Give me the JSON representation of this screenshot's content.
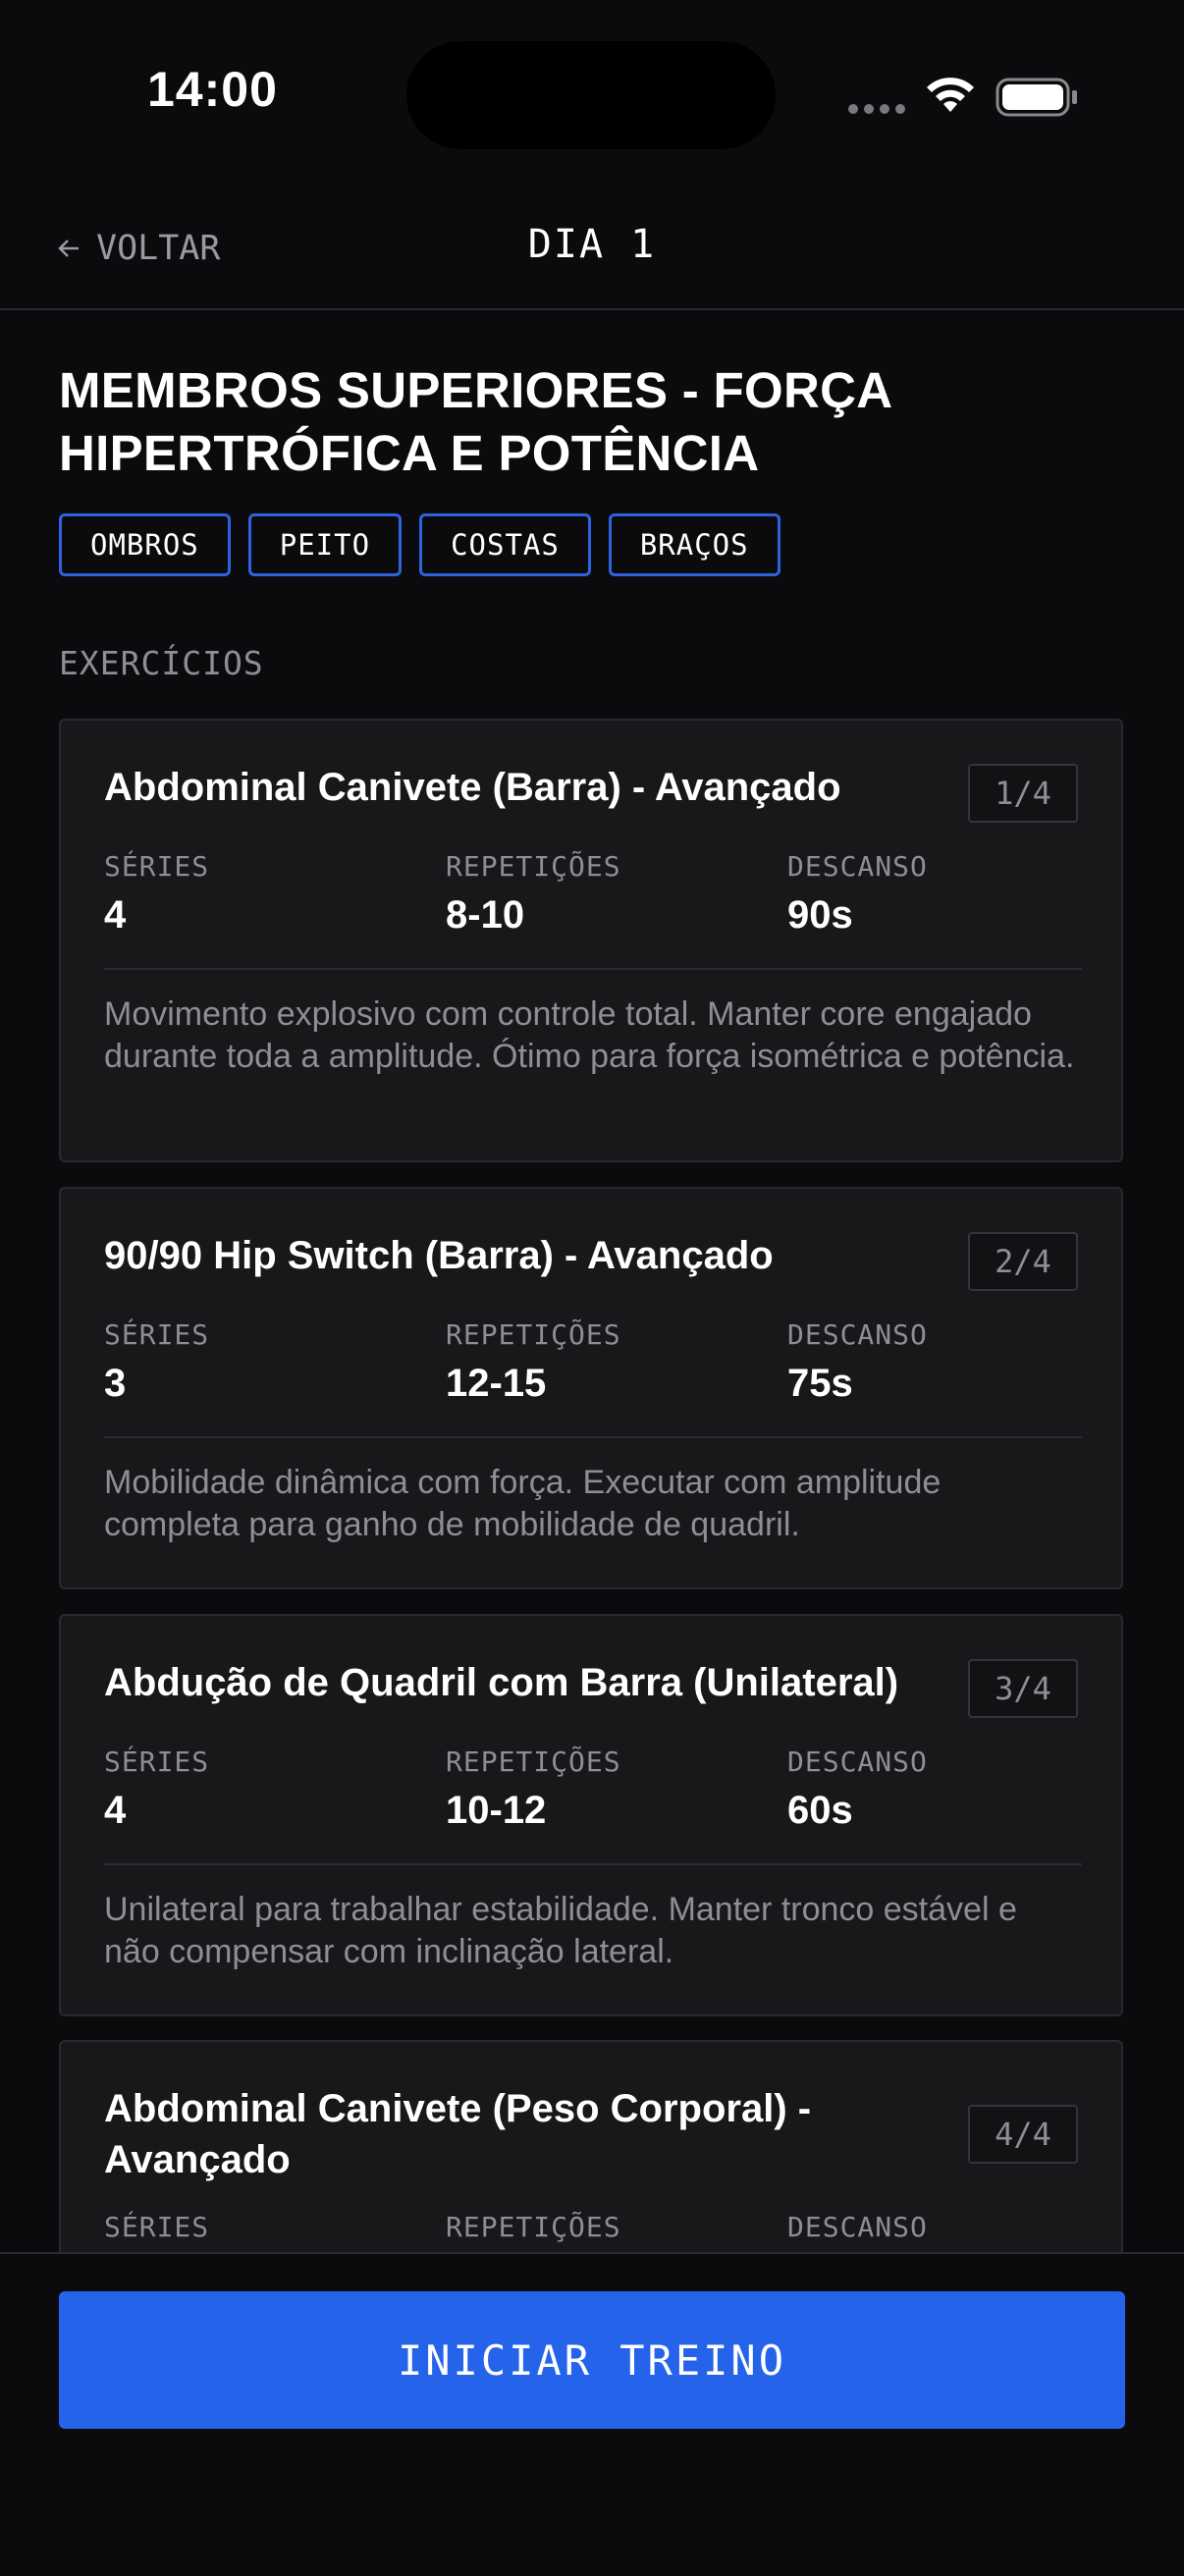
{
  "status_bar": {
    "time": "14:00"
  },
  "nav": {
    "back_label": "VOLTAR",
    "title": "DIA 1"
  },
  "workout": {
    "title": "MEMBROS SUPERIORES - FORÇA HIPERTRÓFICA E POTÊNCIA",
    "tags": [
      "OMBROS",
      "PEITO",
      "COSTAS",
      "BRAÇOS"
    ],
    "section_label": "EXERCÍCIOS"
  },
  "exercises": [
    {
      "name": "Abdominal Canivete (Barra) - Avançado",
      "position": "1/4",
      "sets_label": "SÉRIES",
      "sets": "4",
      "reps_label": "REPETIÇÕES",
      "reps": "8-10",
      "rest_label": "DESCANSO",
      "rest": "90s",
      "description": "Movimento explosivo com controle total. Manter core engajado durante toda a amplitude. Ótimo para força isométrica e potência."
    },
    {
      "name": "90/90 Hip Switch (Barra) - Avançado",
      "position": "2/4",
      "sets_label": "SÉRIES",
      "sets": "3",
      "reps_label": "REPETIÇÕES",
      "reps": "12-15",
      "rest_label": "DESCANSO",
      "rest": "75s",
      "description": "Mobilidade dinâmica com força. Executar com amplitude completa para ganho de mobilidade de quadril."
    },
    {
      "name": "Abdução de Quadril com Barra (Unilateral)",
      "position": "3/4",
      "sets_label": "SÉRIES",
      "sets": "4",
      "reps_label": "REPETIÇÕES",
      "reps": "10-12",
      "rest_label": "DESCANSO",
      "rest": "60s",
      "description": "Unilateral para trabalhar estabilidade. Manter tronco estável e não compensar com inclinação lateral."
    },
    {
      "name": "Abdominal Canivete (Peso Corporal) - Avançado",
      "position": "4/4",
      "sets_label": "SÉRIES",
      "reps_label": "REPETIÇÕES",
      "rest_label": "DESCANSO"
    }
  ],
  "footer": {
    "start_label": "INICIAR TREINO"
  },
  "colors": {
    "background": "#0b0b0d",
    "card": "#18181b",
    "accent": "#2563eb",
    "tag_border": "#2e63e0",
    "muted_text": "#8e8e93"
  }
}
